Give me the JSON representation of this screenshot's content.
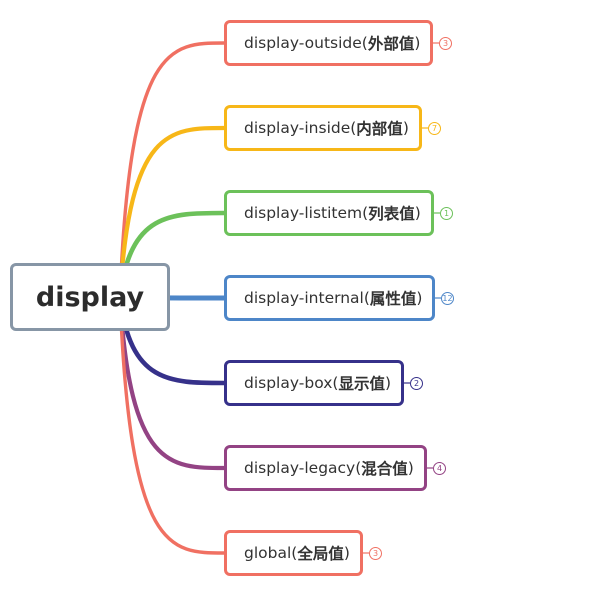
{
  "root": {
    "label": "display"
  },
  "branches": [
    {
      "label": "display-outside(",
      "suffix": "外部值",
      "close": ")",
      "count": "3",
      "color": "#f07062"
    },
    {
      "label": "display-inside(",
      "suffix": "内部值",
      "close": ")",
      "count": "7",
      "color": "#f7b718"
    },
    {
      "label": "display-listitem(",
      "suffix": "列表值",
      "close": ")",
      "count": "1",
      "color": "#6cc15a"
    },
    {
      "label": "display-internal(",
      "suffix": "属性值",
      "close": ")",
      "count": "12",
      "color": "#4d86c8"
    },
    {
      "label": "display-box(",
      "suffix": "显示值",
      "close": ")",
      "count": "2",
      "color": "#36318a"
    },
    {
      "label": "display-legacy(",
      "suffix": "混合值",
      "close": ")",
      "count": "4",
      "color": "#934384"
    },
    {
      "label": "global(",
      "suffix": "全局值",
      "close": ")",
      "count": "3",
      "color": "#f07062"
    }
  ]
}
